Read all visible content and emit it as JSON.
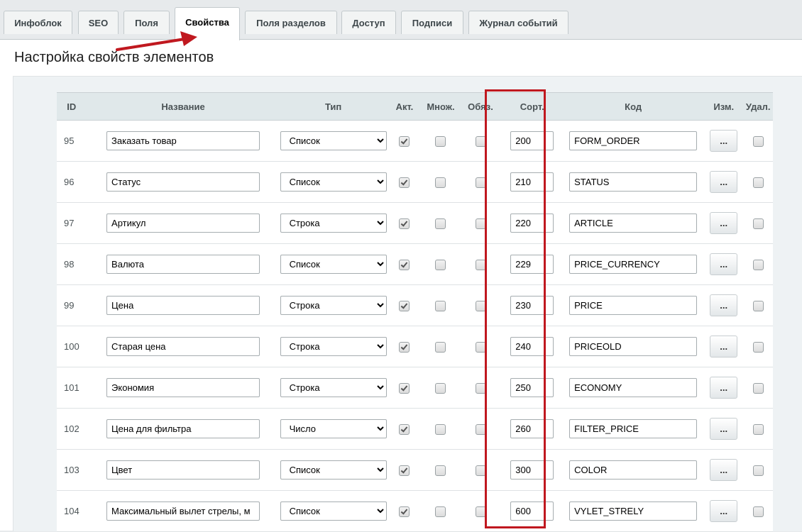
{
  "tabs": [
    {
      "label": "Инфоблок",
      "active": false
    },
    {
      "label": "SEO",
      "active": false
    },
    {
      "label": "Поля",
      "active": false
    },
    {
      "label": "Свойства",
      "active": true
    },
    {
      "label": "Поля разделов",
      "active": false
    },
    {
      "label": "Доступ",
      "active": false
    },
    {
      "label": "Подписи",
      "active": false
    },
    {
      "label": "Журнал событий",
      "active": false
    }
  ],
  "page_title": "Настройка свойств элементов",
  "columns": {
    "id": "ID",
    "name": "Название",
    "type": "Тип",
    "active": "Акт.",
    "multiple": "Множ.",
    "required": "Обяз.",
    "sort": "Сорт.",
    "code": "Код",
    "edit": "Изм.",
    "delete": "Удал."
  },
  "edit_button_label": "...",
  "rows": [
    {
      "id": "95",
      "name": "Заказать товар",
      "type": "Список",
      "active": true,
      "multiple": false,
      "required": false,
      "sort": "200",
      "code": "FORM_ORDER",
      "delete": false
    },
    {
      "id": "96",
      "name": "Статус",
      "type": "Список",
      "active": true,
      "multiple": false,
      "required": false,
      "sort": "210",
      "code": "STATUS",
      "delete": false
    },
    {
      "id": "97",
      "name": "Артикул",
      "type": "Строка",
      "active": true,
      "multiple": false,
      "required": false,
      "sort": "220",
      "code": "ARTICLE",
      "delete": false
    },
    {
      "id": "98",
      "name": "Валюта",
      "type": "Список",
      "active": true,
      "multiple": false,
      "required": false,
      "sort": "229",
      "code": "PRICE_CURRENCY",
      "delete": false
    },
    {
      "id": "99",
      "name": "Цена",
      "type": "Строка",
      "active": true,
      "multiple": false,
      "required": false,
      "sort": "230",
      "code": "PRICE",
      "delete": false
    },
    {
      "id": "100",
      "name": "Старая цена",
      "type": "Строка",
      "active": true,
      "multiple": false,
      "required": false,
      "sort": "240",
      "code": "PRICEOLD",
      "delete": false
    },
    {
      "id": "101",
      "name": "Экономия",
      "type": "Строка",
      "active": true,
      "multiple": false,
      "required": false,
      "sort": "250",
      "code": "ECONOMY",
      "delete": false
    },
    {
      "id": "102",
      "name": "Цена для фильтра",
      "type": "Число",
      "active": true,
      "multiple": false,
      "required": false,
      "sort": "260",
      "code": "FILTER_PRICE",
      "delete": false
    },
    {
      "id": "103",
      "name": "Цвет",
      "type": "Список",
      "active": true,
      "multiple": false,
      "required": false,
      "sort": "300",
      "code": "COLOR",
      "delete": false
    },
    {
      "id": "104",
      "name": "Максимальный вылет стрелы, м",
      "type": "Список",
      "active": true,
      "multiple": false,
      "required": false,
      "sort": "600",
      "code": "VYLET_STRELY",
      "delete": false
    }
  ],
  "colors": {
    "highlight": "#c0181f",
    "arrow": "#c0181f"
  }
}
